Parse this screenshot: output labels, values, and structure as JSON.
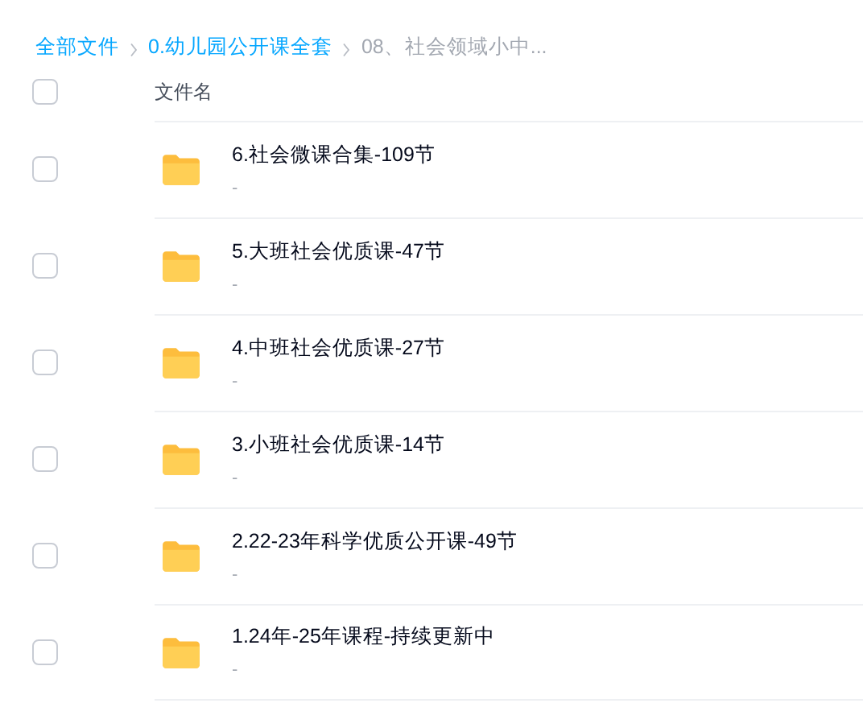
{
  "breadcrumb": [
    {
      "label": "全部文件",
      "current": false
    },
    {
      "label": "0.幼儿园公开课全套",
      "current": false
    },
    {
      "label": "08、社会领域小中...",
      "current": true
    }
  ],
  "table": {
    "select_all": {
      "checked": false
    },
    "columns": [
      "文件名"
    ],
    "rows": [
      {
        "name": "6.社会微课合集-109节",
        "detail": "-",
        "checked": false
      },
      {
        "name": "5.大班社会优质课-47节",
        "detail": "-",
        "checked": false
      },
      {
        "name": "4.中班社会优质课-27节",
        "detail": "-",
        "checked": false
      },
      {
        "name": "3.小班社会优质课-14节",
        "detail": "-",
        "checked": false
      },
      {
        "name": "2.22-23年科学优质公开课-49节",
        "detail": "-",
        "checked": false
      },
      {
        "name": "1.24年-25年课程-持续更新中",
        "detail": "-",
        "checked": false
      }
    ]
  }
}
